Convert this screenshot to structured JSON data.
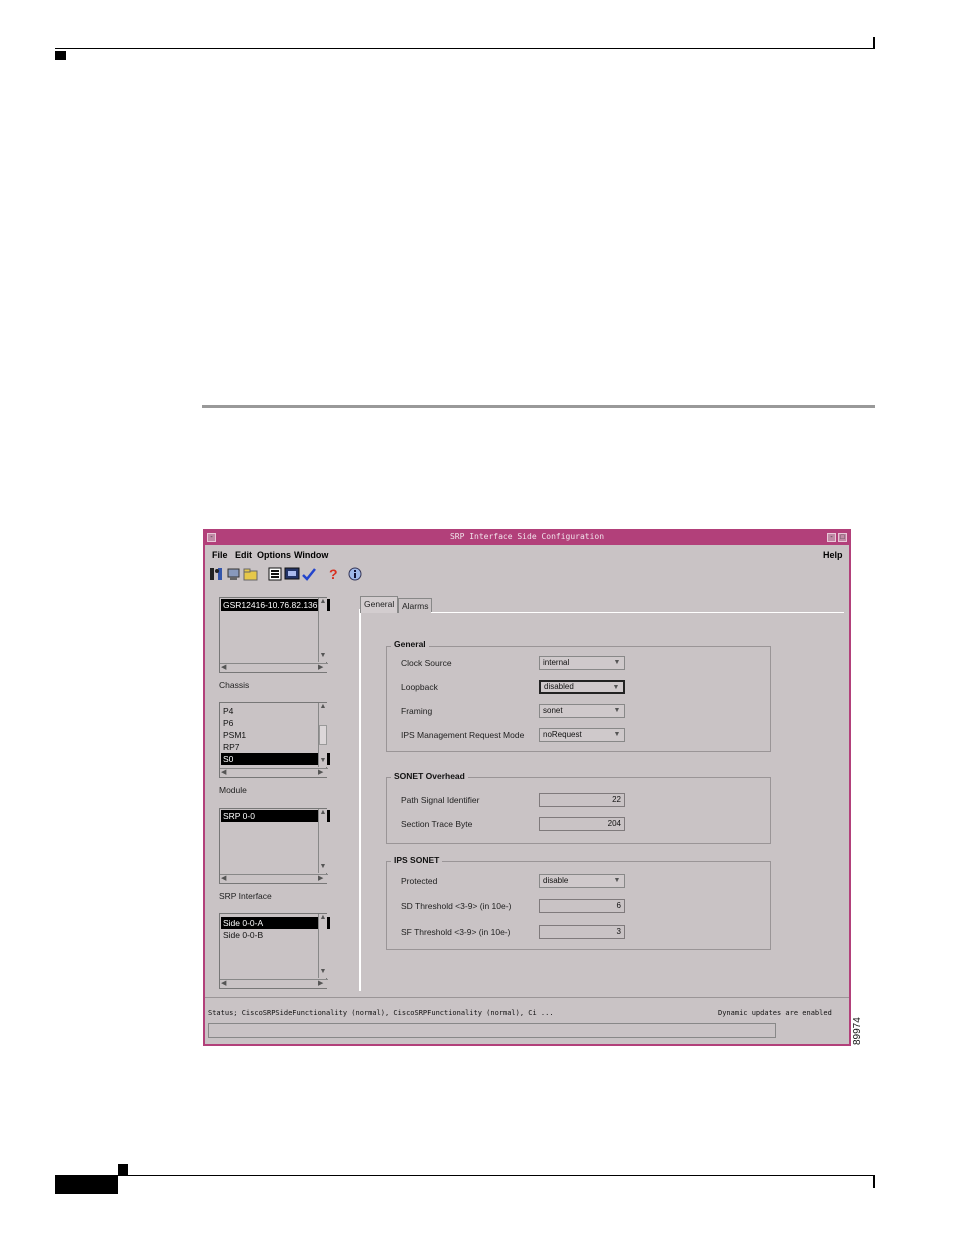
{
  "window": {
    "title": "SRP Interface Side Configuration",
    "minimize_glyph": "-",
    "maximize_glyph": "□",
    "system_glyph": "-"
  },
  "menu": {
    "items": [
      "File",
      "Edit",
      "Options",
      "Window"
    ],
    "help": "Help"
  },
  "toolbar": {
    "icons": [
      "exit-icon",
      "network-icon",
      "folder-icon",
      "list-icon",
      "monitor-icon",
      "check-icon",
      "help-icon",
      "info-icon"
    ]
  },
  "chassis": {
    "label": "Chassis",
    "items": [
      {
        "text": "GSR12416-10.76.82.136",
        "selected": true
      }
    ]
  },
  "module": {
    "label": "Module",
    "items": [
      {
        "text": "P4",
        "selected": false
      },
      {
        "text": "P6",
        "selected": false
      },
      {
        "text": "PSM1",
        "selected": false
      },
      {
        "text": "RP7",
        "selected": false
      },
      {
        "text": "S0",
        "selected": true
      }
    ]
  },
  "srp_interface": {
    "label": "SRP Interface",
    "items": [
      {
        "text": "SRP 0-0",
        "selected": true
      }
    ]
  },
  "sides": {
    "items": [
      {
        "text": "Side 0-0-A",
        "selected": true
      },
      {
        "text": "Side 0-0-B",
        "selected": false
      }
    ]
  },
  "tabs": [
    "General",
    "Alarms"
  ],
  "general": {
    "title": "General",
    "clock_source_label": "Clock Source",
    "clock_source_value": "internal",
    "loopback_label": "Loopback",
    "loopback_value": "disabled",
    "framing_label": "Framing",
    "framing_value": "sonet",
    "ips_mgmt_label": "IPS Management Request Mode",
    "ips_mgmt_value": "noRequest"
  },
  "sonet_overhead": {
    "title": "SONET Overhead",
    "path_signal_label": "Path Signal Identifier",
    "path_signal_value": "22",
    "section_trace_label": "Section Trace Byte",
    "section_trace_value": "204"
  },
  "ips_sonet": {
    "title": "IPS SONET",
    "protected_label": "Protected",
    "protected_value": "disable",
    "sd_label": "SD Threshold <3-9> (in 10e-)",
    "sd_value": "6",
    "sf_label": "SF Threshold <3-9> (in 10e-)",
    "sf_value": "3"
  },
  "status": {
    "text": "Status; CiscoSRPSideFunctionality (normal), CiscoSRPFunctionality (normal), Ci ...",
    "dynamic": "Dynamic updates are enabled"
  },
  "figure_number": "89974"
}
